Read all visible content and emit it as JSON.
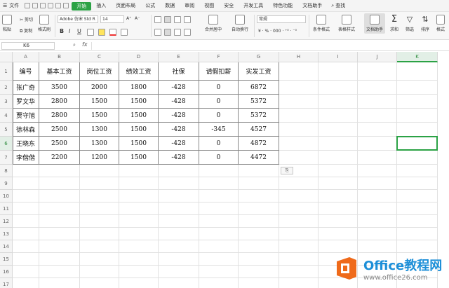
{
  "menubar": {
    "file_label": "文件",
    "tabs": [
      "开始",
      "插入",
      "页面布局",
      "公式",
      "数据",
      "审阅",
      "视图",
      "安全",
      "开发工具",
      "特色功能",
      "文档助手"
    ],
    "active_tab": "开始",
    "search_label": "查找"
  },
  "ribbon": {
    "paste": "粘贴",
    "cut": "剪切",
    "copy": "复制",
    "format_painter": "格式刷",
    "font_name": "Adobe 仿宋 Std R",
    "font_size": "14",
    "bold": "B",
    "italic": "I",
    "underline": "U",
    "merge_center": "合并居中",
    "wrap_text": "自动换行",
    "number_format": "常规",
    "conditional_format": "条件格式",
    "table_style": "表格样式",
    "doc_assistant": "文档助手",
    "sum": "求和",
    "filter": "筛选",
    "sort": "排序",
    "format": "格式"
  },
  "formula_bar": {
    "name_box": "K6",
    "fx_label": "fx",
    "value": ""
  },
  "sheet": {
    "columns": [
      "A",
      "B",
      "C",
      "D",
      "E",
      "F",
      "G",
      "H",
      "I",
      "J",
      "K"
    ],
    "selected_column": "K",
    "rows": [
      "1",
      "2",
      "3",
      "4",
      "5",
      "6",
      "7",
      "8",
      "9",
      "10",
      "11",
      "12",
      "13",
      "14",
      "15",
      "16",
      "17"
    ],
    "selected_row": "6",
    "header_row": [
      "编号",
      "基本工资",
      "岗位工资",
      "绩效工资",
      "社保",
      "请假扣薪",
      "实发工资"
    ],
    "data": [
      [
        "张广奇",
        "3500",
        "2000",
        "1800",
        "-428",
        "0",
        "6872"
      ],
      [
        "罗文华",
        "2800",
        "1500",
        "1500",
        "-428",
        "0",
        "5372"
      ],
      [
        "贾守旭",
        "2800",
        "1500",
        "1500",
        "-428",
        "0",
        "5372"
      ],
      [
        "徐林森",
        "2500",
        "1300",
        "1500",
        "-428",
        "-345",
        "4527"
      ],
      [
        "王晓东",
        "2500",
        "1300",
        "1500",
        "-428",
        "0",
        "4872"
      ],
      [
        "李偕偕",
        "2200",
        "1200",
        "1500",
        "-428",
        "0",
        "4472"
      ]
    ],
    "paste_option_label": "⎘",
    "selected_cell": "K6"
  },
  "watermark": {
    "main": "Office教程网",
    "sub": "www.office26.com"
  },
  "colors": {
    "accent": "#2ba245",
    "watermark_orange": "#ef6a1a"
  }
}
